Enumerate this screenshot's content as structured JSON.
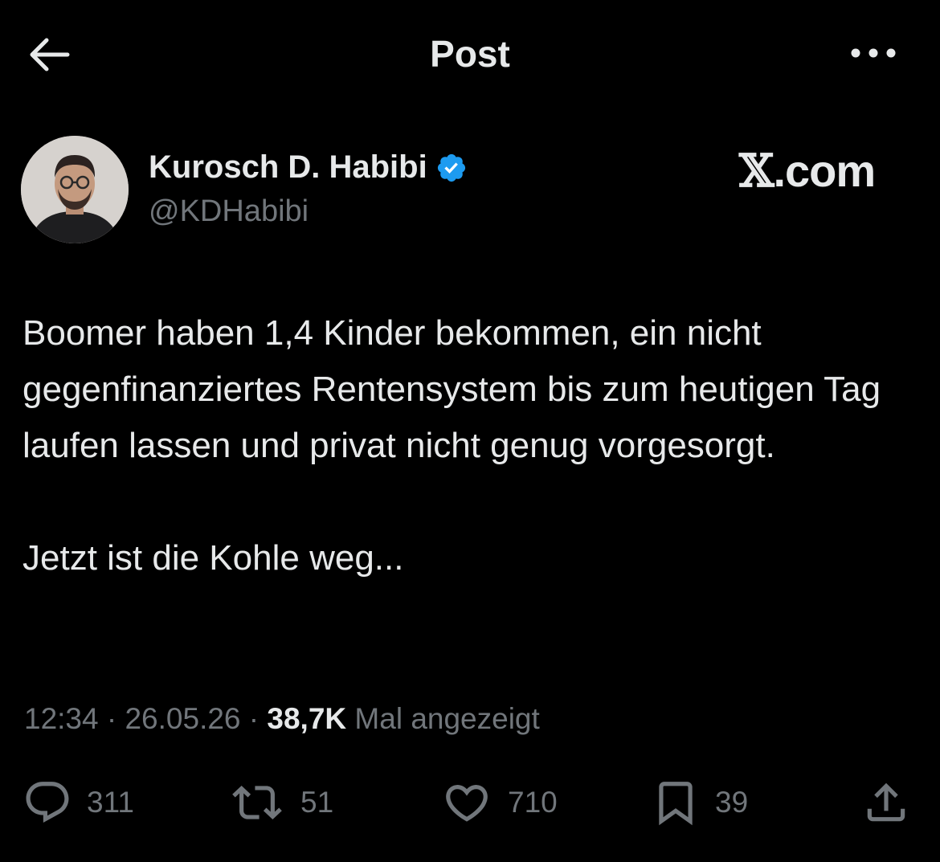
{
  "header": {
    "title": "Post",
    "back_icon": "arrow-left-icon",
    "more_icon": "more-dots-icon"
  },
  "author": {
    "name": "Kurosch D. Habibi",
    "handle": "@KDHabibi",
    "verified_icon": "verified-badge-icon",
    "verified_color": "#1d9bf0"
  },
  "watermark": {
    "x_glyph": "𝕏",
    "suffix": ".com"
  },
  "post": {
    "paragraph_1": "Boomer haben 1,4 Kinder bekommen, ein nicht gegenfinanziertes Rentensystem bis zum heutigen Tag laufen lassen und privat nicht genug vorgesorgt.",
    "paragraph_2": "Jetzt ist die Kohle weg..."
  },
  "meta": {
    "time": "12:34",
    "sep1": " · ",
    "date": "26.05.26",
    "sep2": " · ",
    "views_count": "38,7K",
    "views_label": " Mal angezeigt"
  },
  "actions": {
    "replies": "311",
    "reposts": "51",
    "likes": "710",
    "bookmarks": "39"
  },
  "colors": {
    "background": "#000000",
    "text": "#e7e9ea",
    "secondary": "#71767b",
    "accent": "#1d9bf0"
  }
}
